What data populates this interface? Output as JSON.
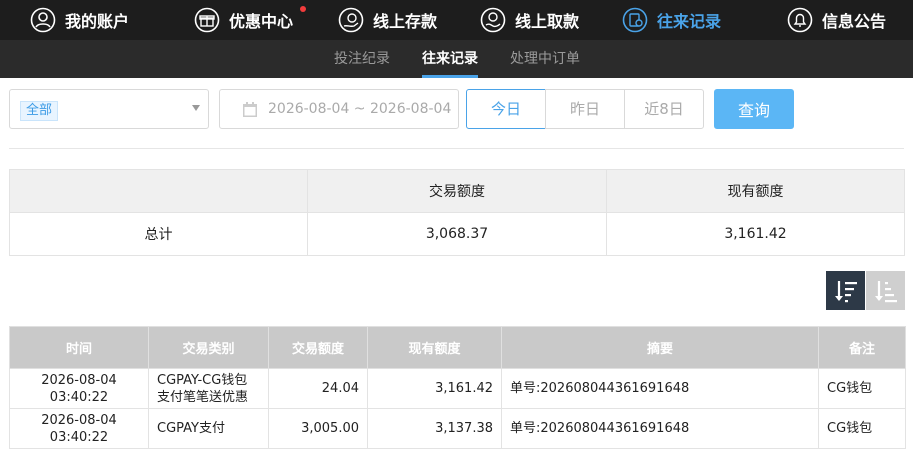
{
  "nav": {
    "items": [
      {
        "label": "我的账户",
        "icon": "user-icon"
      },
      {
        "label": "优惠中心",
        "icon": "gift-icon",
        "badge": true
      },
      {
        "label": "线上存款",
        "icon": "deposit-icon"
      },
      {
        "label": "线上取款",
        "icon": "withdraw-icon"
      },
      {
        "label": "往来记录",
        "icon": "record-icon",
        "active": true
      },
      {
        "label": "信息公告",
        "icon": "bell-icon"
      }
    ]
  },
  "subnav": {
    "tabs": [
      {
        "label": "投注纪录"
      },
      {
        "label": "往来记录",
        "active": true
      },
      {
        "label": "处理中订单"
      }
    ]
  },
  "filter": {
    "type_value": "全部",
    "date_range": "2026-08-04 ~ 2026-08-04",
    "quick": [
      "今日",
      "昨日",
      "近8日"
    ],
    "query_label": "查询"
  },
  "summary": {
    "headers": [
      "",
      "交易额度",
      "现有额度"
    ],
    "row": [
      "总计",
      "3,068.37",
      "3,161.42"
    ]
  },
  "records": {
    "headers": [
      "时间",
      "交易类别",
      "交易额度",
      "现有额度",
      "摘要",
      "备注"
    ],
    "rows": [
      [
        "2026-08-04 03:40:22",
        "CGPAY-CG钱包支付笔笔送优惠",
        "24.04",
        "3,161.42",
        "单号:202608044361691648",
        "CG钱包"
      ],
      [
        "2026-08-04 03:40:22",
        "CGPAY支付",
        "3,005.00",
        "3,137.38",
        "单号:202608044361691648",
        "CG钱包"
      ]
    ]
  },
  "colors": {
    "accent": "#4aa3e8",
    "nav_bg": "#1d1d1d",
    "subnav_bg": "#2b2b2b",
    "query_btn": "#5bb6f5",
    "sort_active": "#2d3947"
  }
}
